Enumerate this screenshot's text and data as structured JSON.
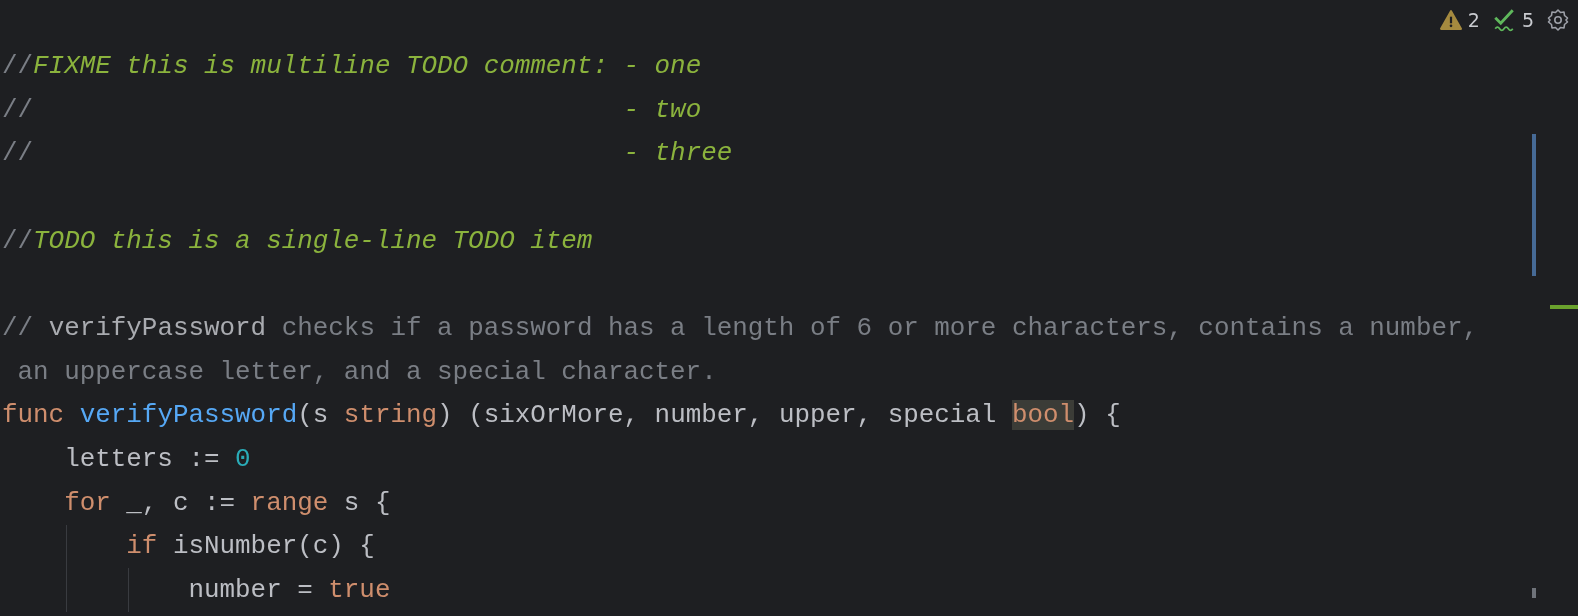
{
  "inspections": [
    {
      "kind": "warning",
      "count": "2"
    },
    {
      "kind": "ok",
      "count": "5"
    }
  ],
  "lines": [
    {
      "kind": "code",
      "tokens": [
        {
          "kind": "comment",
          "text": "//"
        },
        {
          "kind": "todo",
          "text": "FIXME this is multiline TODO comment: - one"
        }
      ]
    },
    {
      "kind": "code",
      "tokens": [
        {
          "kind": "comment",
          "text": "//"
        },
        {
          "kind": "todo",
          "text": "                                      - two"
        }
      ]
    },
    {
      "kind": "code",
      "tokens": [
        {
          "kind": "comment",
          "text": "//"
        },
        {
          "kind": "todo",
          "text": "                                      - three"
        }
      ]
    },
    {
      "kind": "blank"
    },
    {
      "kind": "code",
      "tokens": [
        {
          "kind": "comment",
          "text": "//"
        },
        {
          "kind": "todo",
          "text": "TODO this is a single-line TODO item"
        }
      ]
    },
    {
      "kind": "blank"
    },
    {
      "kind": "code",
      "tokens": [
        {
          "kind": "comment",
          "text": "// "
        },
        {
          "kind": "ref",
          "text": "verifyPassword"
        },
        {
          "kind": "comment",
          "text": " checks if a password has a length of 6 or more characters, contains a number,"
        }
      ]
    },
    {
      "kind": "code",
      "tokens": [
        {
          "kind": "comment",
          "text": " an uppercase letter, and a special character."
        }
      ]
    },
    {
      "kind": "code",
      "tokens": [
        {
          "kind": "keyword",
          "text": "func"
        },
        {
          "kind": "function",
          "text": " verifyPassword"
        },
        {
          "kind": "plain",
          "text": "(s "
        },
        {
          "kind": "type",
          "text": "string"
        },
        {
          "kind": "plain",
          "text": ") (sixOrMore, number, upper, special "
        },
        {
          "kind": "type",
          "text": "bool",
          "highlighted": true
        },
        {
          "kind": "plain",
          "text": ") {"
        }
      ]
    },
    {
      "kind": "code",
      "tokens": [
        {
          "kind": "plain",
          "text": "    letters := "
        },
        {
          "kind": "number",
          "text": "0"
        }
      ]
    },
    {
      "kind": "code",
      "tokens": [
        {
          "kind": "keyword",
          "text": "    for"
        },
        {
          "kind": "plain",
          "text": " _, c := "
        },
        {
          "kind": "keyword",
          "text": "range"
        },
        {
          "kind": "plain",
          "text": " s {"
        }
      ]
    },
    {
      "kind": "code",
      "tokens": [
        {
          "kind": "keyword",
          "text": "        if"
        },
        {
          "kind": "plain",
          "text": " isNumber(c) {"
        }
      ]
    },
    {
      "kind": "code",
      "tokens": [
        {
          "kind": "plain",
          "text": "            number = "
        },
        {
          "kind": "keyword",
          "text": "true"
        }
      ]
    }
  ]
}
